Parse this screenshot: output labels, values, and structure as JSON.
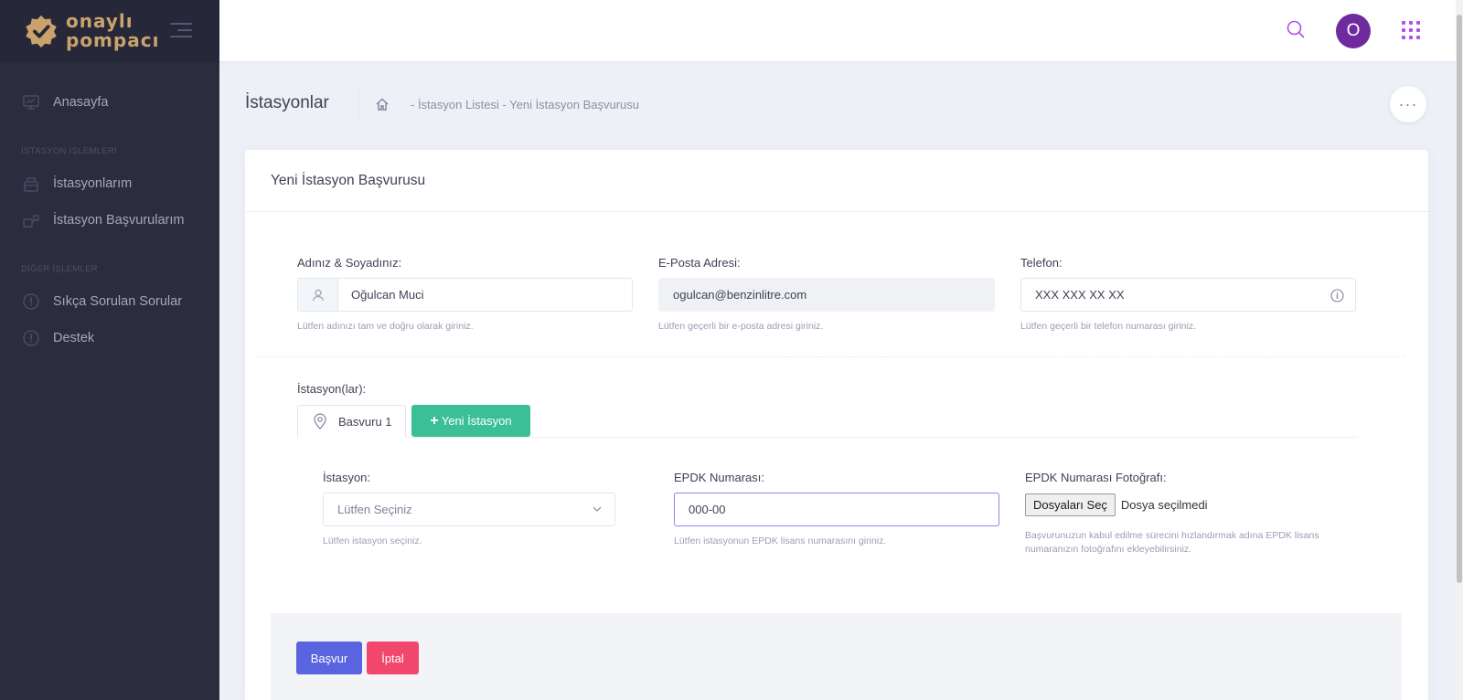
{
  "brand": {
    "name_line1": "onaylı",
    "name_line2": "pompacı"
  },
  "sidebar": {
    "items": [
      {
        "label": "Anasayfa"
      }
    ],
    "sections": [
      {
        "title": "İSTASYON İŞLEMLERİ",
        "items": [
          {
            "label": "İstasyonlarım"
          },
          {
            "label": "İstasyon Başvurularım"
          }
        ]
      },
      {
        "title": "DİĞER İŞLEMLER",
        "items": [
          {
            "label": "Sıkça Sorulan Sorular"
          },
          {
            "label": "Destek"
          }
        ]
      }
    ]
  },
  "topbar": {
    "avatar_letter": "O"
  },
  "subheader": {
    "title": "İstasyonlar",
    "breadcrumb": "-  İstasyon Listesi  -  Yeni İstasyon Başvurusu",
    "more_label": "···"
  },
  "card": {
    "title": "Yeni İstasyon Başvurusu",
    "fields": {
      "name": {
        "label": "Adınız & Soyadınız:",
        "value": "Oğulcan Muci",
        "hint": "Lütfen adınızı tam ve doğru olarak giriniz."
      },
      "email": {
        "label": "E-Posta Adresi:",
        "value": "ogulcan@benzinlitre.com",
        "hint": "Lütfen geçerli bir e-posta adresi giriniz."
      },
      "phone": {
        "label": "Telefon:",
        "placeholder": "XXX XXX XX XX",
        "hint": "Lütfen geçerli bir telefon numarası giriniz."
      }
    },
    "stations_label": "İstasyon(lar):",
    "tabs": [
      {
        "label": "Basvuru 1"
      }
    ],
    "new_station_label": "Yeni İstasyon",
    "station_fields": {
      "station": {
        "label": "İstasyon:",
        "value": "Lütfen Seçiniz",
        "hint": "Lütfen istasyon seçiniz."
      },
      "epdk": {
        "label": "EPDK Numarası:",
        "value": "000-00",
        "hint": "Lütfen istasyonun EPDK lisans numarasını giriniz."
      },
      "photo": {
        "label": "EPDK Numarası Fotoğrafı:",
        "button_label": "Dosyaları Seç",
        "status": "Dosya seçilmedi",
        "hint": "Başvurunuzun kabul edilme sürecini hızlandırmak adına EPDK lisans numaranızın fotoğrafını ekleyebilirsiniz."
      }
    },
    "submit_label": "Başvur",
    "cancel_label": "İptal"
  },
  "colors": {
    "sidebar_bg": "#2b2d3e",
    "primary": "#5a64e0",
    "success": "#3bbf96",
    "danger": "#f1476d",
    "avatar": "#6f2a9e",
    "brand": "#c9a36b"
  }
}
